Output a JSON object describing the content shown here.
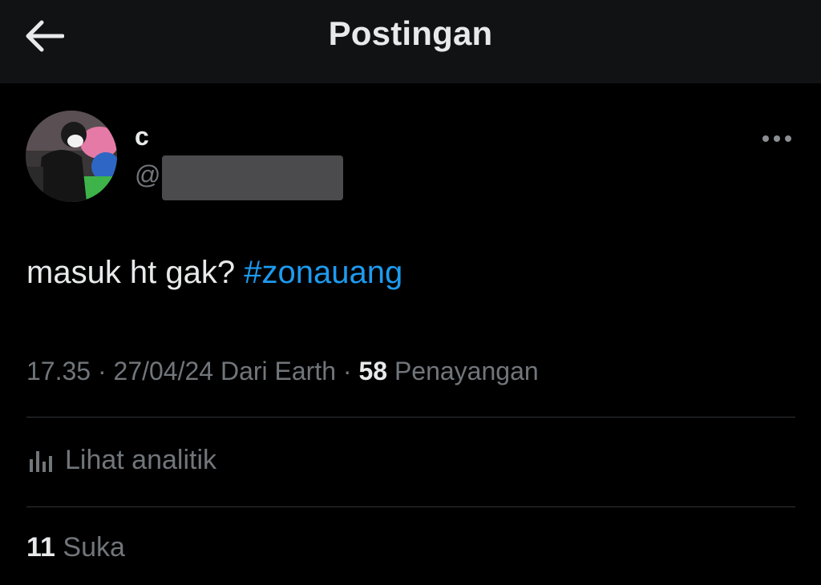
{
  "header": {
    "title": "Postingan",
    "back_icon": "arrow-left-icon"
  },
  "post": {
    "author": {
      "display_name": "c",
      "handle_prefix": "@",
      "avatar_icon": "avatar-photo"
    },
    "more_icon": "more-horizontal-icon",
    "text": "masuk ht gak?",
    "hashtag": "#zonauang",
    "meta": {
      "time": "17.35",
      "separator": "·",
      "date": "27/04/24",
      "source": "Dari Earth",
      "views_count": "58",
      "views_label": "Penayangan"
    },
    "analytics": {
      "icon": "analytics-bar-chart-icon",
      "label": "Lihat analitik"
    },
    "likes": {
      "count": "11",
      "label": "Suka"
    }
  },
  "colors": {
    "background": "#000000",
    "header_background": "#111214",
    "primary_text": "#e7e9ea",
    "secondary_text": "#71767b",
    "link": "#1d9bf0",
    "divider": "#2f3336"
  }
}
